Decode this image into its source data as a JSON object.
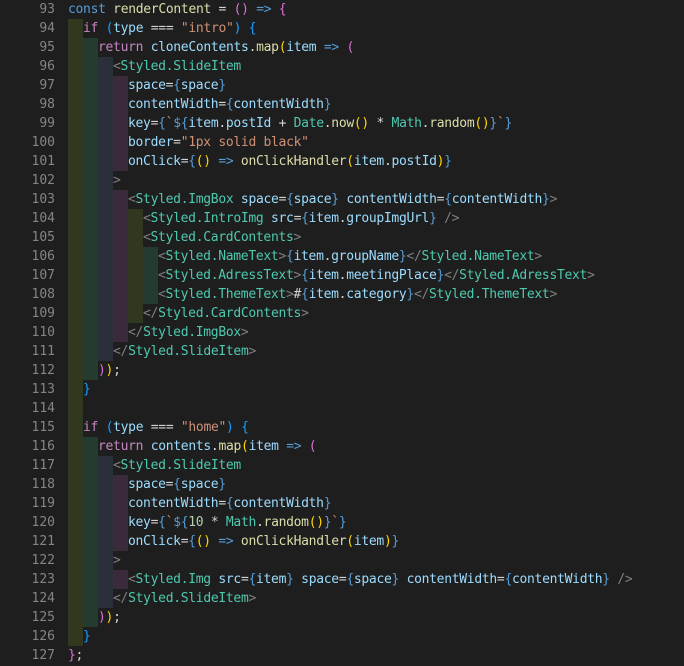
{
  "colors": {
    "background": "#1e1e1e",
    "line_number": "#858585",
    "guide_1": "#303820",
    "guide_2": "#243b2f",
    "guide_3": "#2b2f3a",
    "guide_4": "#3a2b3a"
  },
  "editor": {
    "lines": [
      {
        "num": "93",
        "indent": 0,
        "tokens": [
          [
            "const",
            "#569cd6"
          ],
          [
            " ",
            "#d4d4d4"
          ],
          [
            "renderContent",
            "#dcdcaa"
          ],
          [
            " = ",
            "#d4d4d4"
          ],
          [
            "()",
            "#da70d6"
          ],
          [
            " => ",
            "#569cd6"
          ],
          [
            "{",
            "#da70d6"
          ]
        ]
      },
      {
        "num": "94",
        "indent": 1,
        "tokens": [
          [
            "if",
            "#c586c0"
          ],
          [
            " ",
            "#d4d4d4"
          ],
          [
            "(",
            "#179fff"
          ],
          [
            "type",
            "#9cdcfe"
          ],
          [
            " === ",
            "#d4d4d4"
          ],
          [
            "\"intro\"",
            "#ce9178"
          ],
          [
            ")",
            "#179fff"
          ],
          [
            " ",
            "#d4d4d4"
          ],
          [
            "{",
            "#179fff"
          ]
        ]
      },
      {
        "num": "95",
        "indent": 2,
        "tokens": [
          [
            "return",
            "#c586c0"
          ],
          [
            " ",
            "#d4d4d4"
          ],
          [
            "cloneContents",
            "#9cdcfe"
          ],
          [
            ".",
            "#d4d4d4"
          ],
          [
            "map",
            "#dcdcaa"
          ],
          [
            "(",
            "#ffd700"
          ],
          [
            "item",
            "#9cdcfe"
          ],
          [
            " => ",
            "#569cd6"
          ],
          [
            "(",
            "#da70d6"
          ]
        ]
      },
      {
        "num": "96",
        "indent": 3,
        "tokens": [
          [
            "<",
            "#808080"
          ],
          [
            "Styled.SlideItem",
            "#4ec9b0"
          ]
        ]
      },
      {
        "num": "97",
        "indent": 4,
        "tokens": [
          [
            "space",
            "#9cdcfe"
          ],
          [
            "=",
            "#d4d4d4"
          ],
          [
            "{",
            "#569cd6"
          ],
          [
            "space",
            "#9cdcfe"
          ],
          [
            "}",
            "#569cd6"
          ]
        ]
      },
      {
        "num": "98",
        "indent": 4,
        "tokens": [
          [
            "contentWidth",
            "#9cdcfe"
          ],
          [
            "=",
            "#d4d4d4"
          ],
          [
            "{",
            "#569cd6"
          ],
          [
            "contentWidth",
            "#9cdcfe"
          ],
          [
            "}",
            "#569cd6"
          ]
        ]
      },
      {
        "num": "99",
        "indent": 4,
        "tokens": [
          [
            "key",
            "#9cdcfe"
          ],
          [
            "=",
            "#d4d4d4"
          ],
          [
            "{",
            "#569cd6"
          ],
          [
            "`",
            "#ce9178"
          ],
          [
            "${",
            "#569cd6"
          ],
          [
            "item",
            "#9cdcfe"
          ],
          [
            ".",
            "#d4d4d4"
          ],
          [
            "postId",
            "#9cdcfe"
          ],
          [
            " + ",
            "#d4d4d4"
          ],
          [
            "Date",
            "#4ec9b0"
          ],
          [
            ".",
            "#d4d4d4"
          ],
          [
            "now",
            "#dcdcaa"
          ],
          [
            "()",
            "#ffd700"
          ],
          [
            " * ",
            "#d4d4d4"
          ],
          [
            "Math",
            "#4ec9b0"
          ],
          [
            ".",
            "#d4d4d4"
          ],
          [
            "random",
            "#dcdcaa"
          ],
          [
            "()",
            "#ffd700"
          ],
          [
            "}",
            "#569cd6"
          ],
          [
            "`",
            "#ce9178"
          ],
          [
            "}",
            "#569cd6"
          ]
        ]
      },
      {
        "num": "100",
        "indent": 4,
        "tokens": [
          [
            "border",
            "#9cdcfe"
          ],
          [
            "=",
            "#d4d4d4"
          ],
          [
            "\"1px solid black\"",
            "#ce9178"
          ]
        ]
      },
      {
        "num": "101",
        "indent": 4,
        "tokens": [
          [
            "onClick",
            "#9cdcfe"
          ],
          [
            "=",
            "#d4d4d4"
          ],
          [
            "{",
            "#569cd6"
          ],
          [
            "()",
            "#ffd700"
          ],
          [
            " => ",
            "#569cd6"
          ],
          [
            "onClickHandler",
            "#dcdcaa"
          ],
          [
            "(",
            "#ffd700"
          ],
          [
            "item",
            "#9cdcfe"
          ],
          [
            ".",
            "#d4d4d4"
          ],
          [
            "postId",
            "#9cdcfe"
          ],
          [
            ")",
            "#ffd700"
          ],
          [
            "}",
            "#569cd6"
          ]
        ]
      },
      {
        "num": "102",
        "indent": 3,
        "tokens": [
          [
            ">",
            "#808080"
          ]
        ]
      },
      {
        "num": "103",
        "indent": 4,
        "tokens": [
          [
            "<",
            "#808080"
          ],
          [
            "Styled.ImgBox",
            "#4ec9b0"
          ],
          [
            " ",
            "#d4d4d4"
          ],
          [
            "space",
            "#9cdcfe"
          ],
          [
            "=",
            "#d4d4d4"
          ],
          [
            "{",
            "#569cd6"
          ],
          [
            "space",
            "#9cdcfe"
          ],
          [
            "}",
            "#569cd6"
          ],
          [
            " ",
            "#d4d4d4"
          ],
          [
            "contentWidth",
            "#9cdcfe"
          ],
          [
            "=",
            "#d4d4d4"
          ],
          [
            "{",
            "#569cd6"
          ],
          [
            "contentWidth",
            "#9cdcfe"
          ],
          [
            "}",
            "#569cd6"
          ],
          [
            ">",
            "#808080"
          ]
        ]
      },
      {
        "num": "104",
        "indent": 5,
        "tokens": [
          [
            "<",
            "#808080"
          ],
          [
            "Styled.IntroImg",
            "#4ec9b0"
          ],
          [
            " ",
            "#d4d4d4"
          ],
          [
            "src",
            "#9cdcfe"
          ],
          [
            "=",
            "#d4d4d4"
          ],
          [
            "{",
            "#569cd6"
          ],
          [
            "item",
            "#9cdcfe"
          ],
          [
            ".",
            "#d4d4d4"
          ],
          [
            "groupImgUrl",
            "#9cdcfe"
          ],
          [
            "}",
            "#569cd6"
          ],
          [
            " />",
            "#808080"
          ]
        ]
      },
      {
        "num": "105",
        "indent": 5,
        "tokens": [
          [
            "<",
            "#808080"
          ],
          [
            "Styled.CardContents",
            "#4ec9b0"
          ],
          [
            ">",
            "#808080"
          ]
        ]
      },
      {
        "num": "106",
        "indent": 6,
        "tokens": [
          [
            "<",
            "#808080"
          ],
          [
            "Styled.NameText",
            "#4ec9b0"
          ],
          [
            ">",
            "#808080"
          ],
          [
            "{",
            "#569cd6"
          ],
          [
            "item",
            "#9cdcfe"
          ],
          [
            ".",
            "#d4d4d4"
          ],
          [
            "groupName",
            "#9cdcfe"
          ],
          [
            "}",
            "#569cd6"
          ],
          [
            "</",
            "#808080"
          ],
          [
            "Styled.NameText",
            "#4ec9b0"
          ],
          [
            ">",
            "#808080"
          ]
        ]
      },
      {
        "num": "107",
        "indent": 6,
        "tokens": [
          [
            "<",
            "#808080"
          ],
          [
            "Styled.AdressText",
            "#4ec9b0"
          ],
          [
            ">",
            "#808080"
          ],
          [
            "{",
            "#569cd6"
          ],
          [
            "item",
            "#9cdcfe"
          ],
          [
            ".",
            "#d4d4d4"
          ],
          [
            "meetingPlace",
            "#9cdcfe"
          ],
          [
            "}",
            "#569cd6"
          ],
          [
            "</",
            "#808080"
          ],
          [
            "Styled.AdressText",
            "#4ec9b0"
          ],
          [
            ">",
            "#808080"
          ]
        ]
      },
      {
        "num": "108",
        "indent": 6,
        "tokens": [
          [
            "<",
            "#808080"
          ],
          [
            "Styled.ThemeText",
            "#4ec9b0"
          ],
          [
            ">",
            "#808080"
          ],
          [
            "#",
            "#d4d4d4"
          ],
          [
            "{",
            "#569cd6"
          ],
          [
            "item",
            "#9cdcfe"
          ],
          [
            ".",
            "#d4d4d4"
          ],
          [
            "category",
            "#9cdcfe"
          ],
          [
            "}",
            "#569cd6"
          ],
          [
            "</",
            "#808080"
          ],
          [
            "Styled.ThemeText",
            "#4ec9b0"
          ],
          [
            ">",
            "#808080"
          ]
        ]
      },
      {
        "num": "109",
        "indent": 5,
        "tokens": [
          [
            "</",
            "#808080"
          ],
          [
            "Styled.CardContents",
            "#4ec9b0"
          ],
          [
            ">",
            "#808080"
          ]
        ]
      },
      {
        "num": "110",
        "indent": 4,
        "tokens": [
          [
            "</",
            "#808080"
          ],
          [
            "Styled.ImgBox",
            "#4ec9b0"
          ],
          [
            ">",
            "#808080"
          ]
        ]
      },
      {
        "num": "111",
        "indent": 3,
        "tokens": [
          [
            "</",
            "#808080"
          ],
          [
            "Styled.SlideItem",
            "#4ec9b0"
          ],
          [
            ">",
            "#808080"
          ]
        ]
      },
      {
        "num": "112",
        "indent": 2,
        "tokens": [
          [
            ")",
            "#da70d6"
          ],
          [
            ")",
            "#ffd700"
          ],
          [
            ";",
            "#d4d4d4"
          ]
        ]
      },
      {
        "num": "113",
        "indent": 1,
        "tokens": [
          [
            "}",
            "#179fff"
          ]
        ]
      },
      {
        "num": "114",
        "indent": 1,
        "tokens": []
      },
      {
        "num": "115",
        "indent": 1,
        "tokens": [
          [
            "if",
            "#c586c0"
          ],
          [
            " ",
            "#d4d4d4"
          ],
          [
            "(",
            "#179fff"
          ],
          [
            "type",
            "#9cdcfe"
          ],
          [
            " === ",
            "#d4d4d4"
          ],
          [
            "\"home\"",
            "#ce9178"
          ],
          [
            ")",
            "#179fff"
          ],
          [
            " ",
            "#d4d4d4"
          ],
          [
            "{",
            "#179fff"
          ]
        ]
      },
      {
        "num": "116",
        "indent": 2,
        "tokens": [
          [
            "return",
            "#c586c0"
          ],
          [
            " ",
            "#d4d4d4"
          ],
          [
            "contents",
            "#9cdcfe"
          ],
          [
            ".",
            "#d4d4d4"
          ],
          [
            "map",
            "#dcdcaa"
          ],
          [
            "(",
            "#ffd700"
          ],
          [
            "item",
            "#9cdcfe"
          ],
          [
            " => ",
            "#569cd6"
          ],
          [
            "(",
            "#da70d6"
          ]
        ]
      },
      {
        "num": "117",
        "indent": 3,
        "tokens": [
          [
            "<",
            "#808080"
          ],
          [
            "Styled.SlideItem",
            "#4ec9b0"
          ]
        ]
      },
      {
        "num": "118",
        "indent": 4,
        "tokens": [
          [
            "space",
            "#9cdcfe"
          ],
          [
            "=",
            "#d4d4d4"
          ],
          [
            "{",
            "#569cd6"
          ],
          [
            "space",
            "#9cdcfe"
          ],
          [
            "}",
            "#569cd6"
          ]
        ]
      },
      {
        "num": "119",
        "indent": 4,
        "tokens": [
          [
            "contentWidth",
            "#9cdcfe"
          ],
          [
            "=",
            "#d4d4d4"
          ],
          [
            "{",
            "#569cd6"
          ],
          [
            "contentWidth",
            "#9cdcfe"
          ],
          [
            "}",
            "#569cd6"
          ]
        ]
      },
      {
        "num": "120",
        "indent": 4,
        "tokens": [
          [
            "key",
            "#9cdcfe"
          ],
          [
            "=",
            "#d4d4d4"
          ],
          [
            "{",
            "#569cd6"
          ],
          [
            "`",
            "#ce9178"
          ],
          [
            "${",
            "#569cd6"
          ],
          [
            "10",
            "#b5cea8"
          ],
          [
            " * ",
            "#d4d4d4"
          ],
          [
            "Math",
            "#4ec9b0"
          ],
          [
            ".",
            "#d4d4d4"
          ],
          [
            "random",
            "#dcdcaa"
          ],
          [
            "()",
            "#ffd700"
          ],
          [
            "}",
            "#569cd6"
          ],
          [
            "`",
            "#ce9178"
          ],
          [
            "}",
            "#569cd6"
          ]
        ]
      },
      {
        "num": "121",
        "indent": 4,
        "tokens": [
          [
            "onClick",
            "#9cdcfe"
          ],
          [
            "=",
            "#d4d4d4"
          ],
          [
            "{",
            "#569cd6"
          ],
          [
            "()",
            "#ffd700"
          ],
          [
            " => ",
            "#569cd6"
          ],
          [
            "onClickHandler",
            "#dcdcaa"
          ],
          [
            "(",
            "#ffd700"
          ],
          [
            "item",
            "#9cdcfe"
          ],
          [
            ")",
            "#ffd700"
          ],
          [
            "}",
            "#569cd6"
          ]
        ]
      },
      {
        "num": "122",
        "indent": 3,
        "tokens": [
          [
            ">",
            "#808080"
          ]
        ]
      },
      {
        "num": "123",
        "indent": 4,
        "tokens": [
          [
            "<",
            "#808080"
          ],
          [
            "Styled.Img",
            "#4ec9b0"
          ],
          [
            " ",
            "#d4d4d4"
          ],
          [
            "src",
            "#9cdcfe"
          ],
          [
            "=",
            "#d4d4d4"
          ],
          [
            "{",
            "#569cd6"
          ],
          [
            "item",
            "#9cdcfe"
          ],
          [
            "}",
            "#569cd6"
          ],
          [
            " ",
            "#d4d4d4"
          ],
          [
            "space",
            "#9cdcfe"
          ],
          [
            "=",
            "#d4d4d4"
          ],
          [
            "{",
            "#569cd6"
          ],
          [
            "space",
            "#9cdcfe"
          ],
          [
            "}",
            "#569cd6"
          ],
          [
            " ",
            "#d4d4d4"
          ],
          [
            "contentWidth",
            "#9cdcfe"
          ],
          [
            "=",
            "#d4d4d4"
          ],
          [
            "{",
            "#569cd6"
          ],
          [
            "contentWidth",
            "#9cdcfe"
          ],
          [
            "}",
            "#569cd6"
          ],
          [
            " />",
            "#808080"
          ]
        ]
      },
      {
        "num": "124",
        "indent": 3,
        "tokens": [
          [
            "</",
            "#808080"
          ],
          [
            "Styled.SlideItem",
            "#4ec9b0"
          ],
          [
            ">",
            "#808080"
          ]
        ]
      },
      {
        "num": "125",
        "indent": 2,
        "tokens": [
          [
            ")",
            "#da70d6"
          ],
          [
            ")",
            "#ffd700"
          ],
          [
            ";",
            "#d4d4d4"
          ]
        ]
      },
      {
        "num": "126",
        "indent": 1,
        "tokens": [
          [
            "}",
            "#179fff"
          ]
        ]
      },
      {
        "num": "127",
        "indent": 0,
        "tokens": [
          [
            "}",
            "#da70d6"
          ],
          [
            ";",
            "#d4d4d4"
          ]
        ]
      }
    ]
  }
}
